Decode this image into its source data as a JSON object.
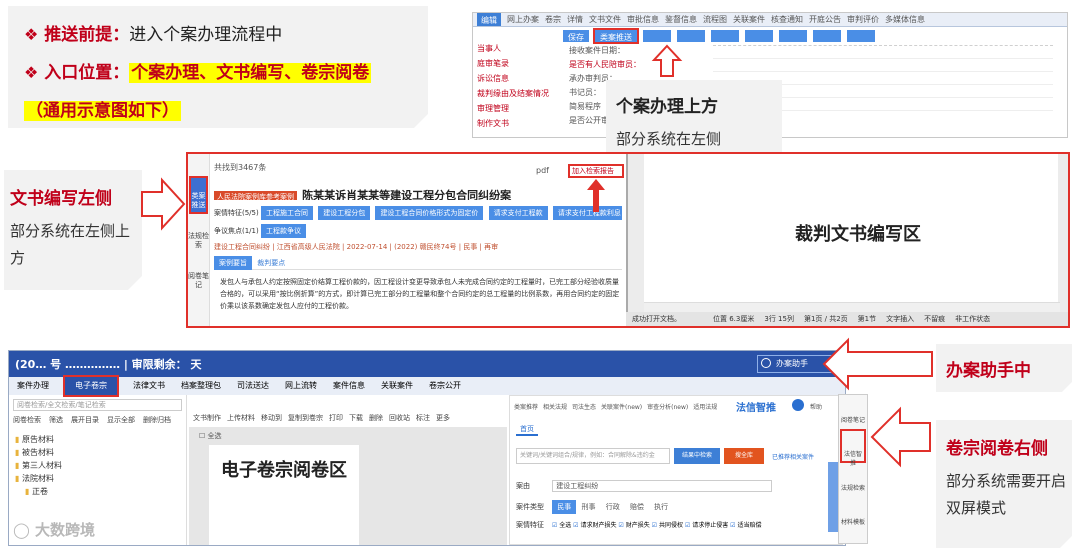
{
  "intro": {
    "line1_label": "推送前提：",
    "line1_text": "进入个案办理流程中",
    "line2_label": "入口位置：",
    "line2_text": "个案办理、文书编写、卷宗阅卷",
    "line3_text": "（通用示意图如下）"
  },
  "case_handling": {
    "title": "个案办理上方",
    "subtitle": "部分系统在左侧",
    "tabs": [
      "编辑",
      "网上办案",
      "卷宗",
      "详情",
      "文书文件",
      "审批信息",
      "鉴督信息",
      "流程图",
      "关联案件",
      "核查通知",
      "开庭公告",
      "审判评价",
      "多媒体信息"
    ],
    "left_items": [
      "当事人",
      "庭审笔录",
      "诉讼信息",
      "裁判缘由及结案情况",
      "审理管理",
      "制作文书"
    ],
    "fields": [
      "接收案件日期：",
      "是否有人民陪审员：",
      "承办审判员：",
      "书记员：",
      "简易程序",
      "是否公开审理："
    ],
    "toolbar": [
      "保存",
      "类案推送"
    ]
  },
  "doc_writing": {
    "title": "文书编写左侧",
    "subtitle": "部分系统在左侧上方",
    "sidebar": [
      "类案推送",
      "法规检索",
      "阅卷笔记"
    ],
    "case_title": "陈某某诉肖某某等建设工程分包合同纠纷案",
    "case_tag": "人民法院案例库参考案例",
    "count_text": "共找到3467条",
    "push_btn": "加入检索报告",
    "tags_label": "案情特征(5/5)",
    "tags": [
      "工程施工合同",
      "建设工程分包",
      "建设工程合同价格形式为固定价",
      "请求支付工程款",
      "请求支付工程款利息"
    ],
    "dispute_label": "争议焦点(1/1)",
    "dispute_tag": "工程款争议",
    "meta": "建设工程合同纠纷 | 江西省高级人民法院 | 2022-07-14 | (2022) 赣民终74号 | 民事 | 再审",
    "sub_tabs": [
      "案例要旨",
      "裁判要点"
    ],
    "body": "发包人与承包人约定按照固定价结算工程价款的，因工程设计变更导致承包人未完成合同约定的工程量时，已完工部分经验收质量合格的，可以采用“按比例折算”的方式，即计算已完工部分的工程量和整个合同约定的总工程量的比例系数，再用合同约定的固定价乘以该系数确定发包人应付的工程价款。",
    "editor_label": "裁判文书编写区",
    "status_items": [
      "成功打开文档。",
      "位置 6.3厘米",
      "3行 15列",
      "第1页 / 共2页",
      "第1节",
      "文字插入",
      "不留痕",
      "非工作状态"
    ],
    "ext_label": "pdf"
  },
  "file_review": {
    "title_bar": "(20…  号 …………… | 审限剩余：  天",
    "assistant_btn": "办案助手",
    "tabs": [
      "案件办理",
      "电子卷宗",
      "法律文书",
      "档案整理包",
      "司法送达",
      "网上流转",
      "案件信息",
      "关联案件",
      "卷宗公开"
    ],
    "toolbar_left": [
      "阅卷检索",
      "筛选",
      "展开目录",
      "显示全部",
      "删除归档"
    ],
    "toolbar_mid": [
      "文书制作",
      "上传材料",
      "移动到",
      "复制到卷宗",
      "打印",
      "下载",
      "删除",
      "回收站",
      "标注",
      "更多"
    ],
    "search_ph": "阅卷检索/全文检索/笔记检索",
    "tree": [
      "原告材料",
      "被告材料",
      "第三人材料",
      "法院材料",
      "正卷"
    ],
    "select_all": "全选",
    "reader_label": "电子卷宗阅卷区",
    "panel_tabs": [
      "类案推荐",
      "相关法规",
      "司法生态",
      "关联案件(new)",
      "审查分析(new)",
      "适用法规"
    ],
    "panel_brand": "法信智推",
    "panel_help": "帮助",
    "panel_sub_tab": "首页",
    "panel_search_ph": "关键词/关键词组合/规律，例如：合同解除&违约金",
    "panel_btn1": "结果中检索",
    "panel_btn2": "搜全库",
    "panel_link": "已推荐相关案件",
    "panel_reason_label": "案由",
    "panel_reason_val": "建设工程纠纷",
    "panel_type_label": "案件类型",
    "panel_types": [
      "民事",
      "刑事",
      "行政",
      "赔偿",
      "执行"
    ],
    "panel_feature_label": "案情特征",
    "panel_features": [
      "全选",
      "请求财产损失",
      "财产损失",
      "共同侵权",
      "请求停止侵害",
      "适当赔偿"
    ],
    "right_rail": [
      "阅卷笔记",
      "法信智推",
      "法规检索",
      "材料模板"
    ],
    "watermark": "大数跨境"
  },
  "assistant_callout": {
    "title": "办案助手中"
  },
  "review_callout": {
    "title": "卷宗阅卷右侧",
    "subtitle": "部分系统需要开启双屏模式"
  },
  "colors": {
    "accent_red": "#c0001a",
    "frame_red": "#e0302a",
    "tab_blue": "#3d7fd6",
    "highlight_yellow": "#ffff00"
  }
}
